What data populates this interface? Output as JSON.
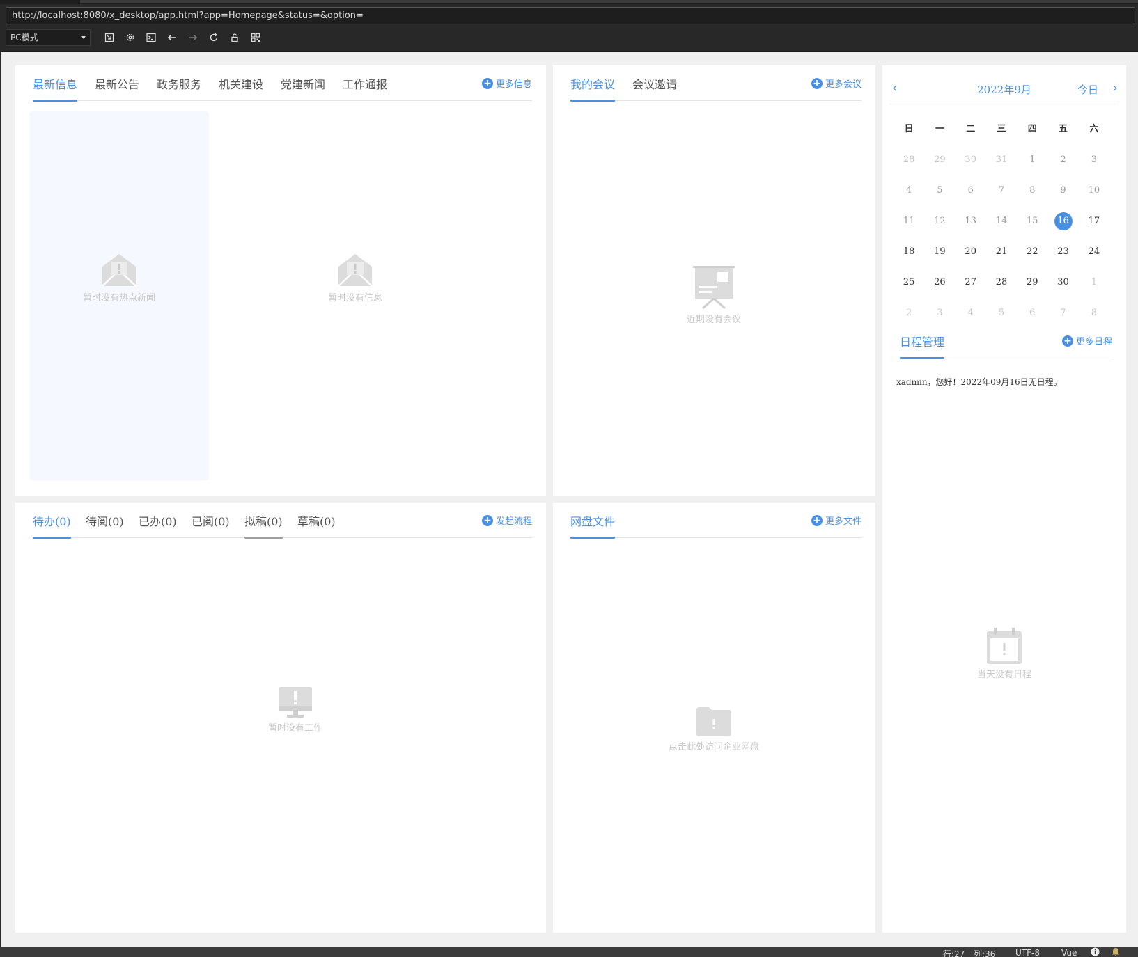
{
  "browser": {
    "url": "http://localhost:8080/x_desktop/app.html?app=Homepage&status=&option=",
    "mode": "PC模式",
    "tool_icons": [
      "new-window-icon",
      "settings-icon",
      "console-icon",
      "back-icon",
      "forward-icon",
      "reload-icon",
      "lock-icon",
      "qr-icon"
    ]
  },
  "info_panel": {
    "tabs": [
      "最新信息",
      "最新公告",
      "政务服务",
      "机关建设",
      "党建新闻",
      "工作通报"
    ],
    "active_tab": 0,
    "more": "更多信息",
    "hot_empty": "暂时没有热点新闻",
    "list_empty": "暂时没有信息"
  },
  "meeting_panel": {
    "tabs": [
      "我的会议",
      "会议邀请"
    ],
    "active_tab": 0,
    "more": "更多会议",
    "empty": "近期没有会议"
  },
  "work_panel": {
    "tabs": [
      "待办(0)",
      "待阅(0)",
      "已办(0)",
      "已阅(0)",
      "拟稿(0)",
      "草稿(0)"
    ],
    "active_tab": 0,
    "more": "发起流程",
    "empty": "暂时没有工作"
  },
  "disk_panel": {
    "tabs": [
      "网盘文件"
    ],
    "more": "更多文件",
    "empty": "点击此处访问企业网盘"
  },
  "calendar": {
    "title": "2022年9月",
    "today": "今日",
    "weekdays": [
      "日",
      "一",
      "二",
      "三",
      "四",
      "五",
      "六"
    ],
    "weeks": [
      [
        "28",
        "29",
        "30",
        "31",
        "1",
        "2",
        "3"
      ],
      [
        "4",
        "5",
        "6",
        "7",
        "8",
        "9",
        "10"
      ],
      [
        "11",
        "12",
        "13",
        "14",
        "15",
        "16",
        "17"
      ],
      [
        "18",
        "19",
        "20",
        "21",
        "22",
        "23",
        "24"
      ],
      [
        "25",
        "26",
        "27",
        "28",
        "29",
        "30",
        "1"
      ],
      [
        "2",
        "3",
        "4",
        "5",
        "6",
        "7",
        "8"
      ]
    ],
    "selected": "16",
    "schedule_title": "日程管理",
    "schedule_more": "更多日程",
    "greeting": "xadmin，您好！2022年09月16日无日程。",
    "schedule_empty": "当天没有日程"
  },
  "accent_color": "#4a90e2",
  "statusbar": {
    "row": "行:27",
    "col": "列:36",
    "encoding": "UTF-8",
    "language": "Vue"
  }
}
